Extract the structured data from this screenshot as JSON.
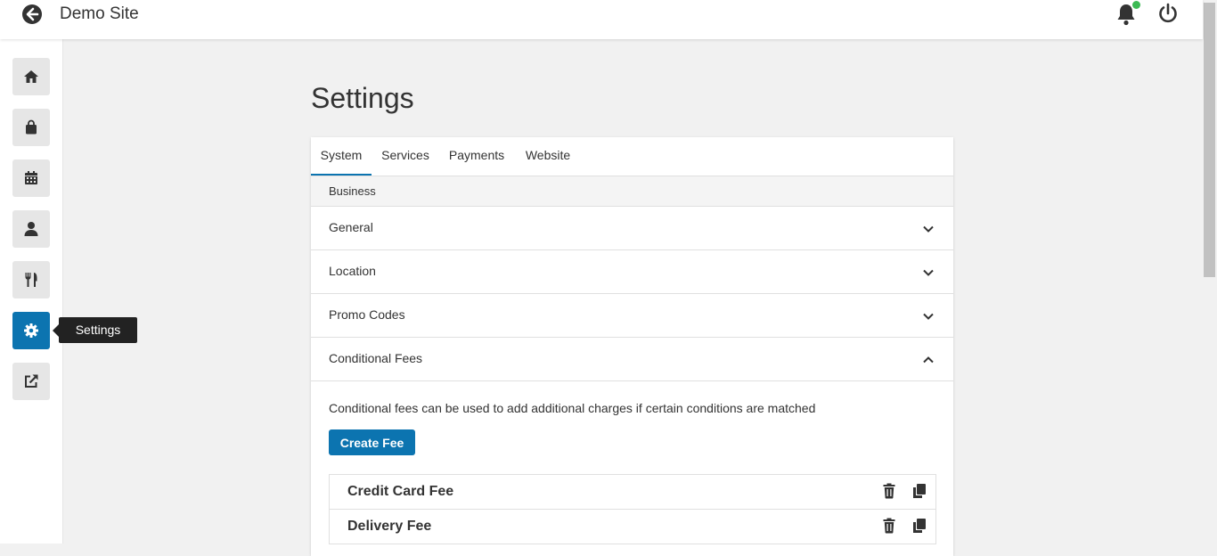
{
  "header": {
    "site_title": "Demo Site"
  },
  "sidebar": {
    "items": [
      {
        "name": "home",
        "icon": "home-icon"
      },
      {
        "name": "orders",
        "icon": "shopping-bag-icon"
      },
      {
        "name": "calendar",
        "icon": "calendar-icon"
      },
      {
        "name": "customers",
        "icon": "user-icon"
      },
      {
        "name": "menu",
        "icon": "utensils-icon"
      },
      {
        "name": "settings",
        "icon": "gear-icon",
        "active": true
      },
      {
        "name": "external",
        "icon": "external-link-icon"
      }
    ],
    "tooltip": "Settings"
  },
  "page": {
    "title": "Settings"
  },
  "tabs": [
    {
      "label": "System",
      "active": true
    },
    {
      "label": "Services"
    },
    {
      "label": "Payments"
    },
    {
      "label": "Website"
    }
  ],
  "section": {
    "label": "Business"
  },
  "accordion": [
    {
      "label": "General",
      "expanded": false
    },
    {
      "label": "Location",
      "expanded": false
    },
    {
      "label": "Promo Codes",
      "expanded": false
    },
    {
      "label": "Conditional Fees",
      "expanded": true
    }
  ],
  "conditional_fees": {
    "description": "Conditional fees can be used to add additional charges if certain conditions are matched",
    "create_label": "Create Fee",
    "fees": [
      {
        "name": "Credit Card Fee"
      },
      {
        "name": "Delivery Fee"
      }
    ]
  },
  "colors": {
    "accent": "#0c74b0",
    "notification": "#3cba54"
  }
}
